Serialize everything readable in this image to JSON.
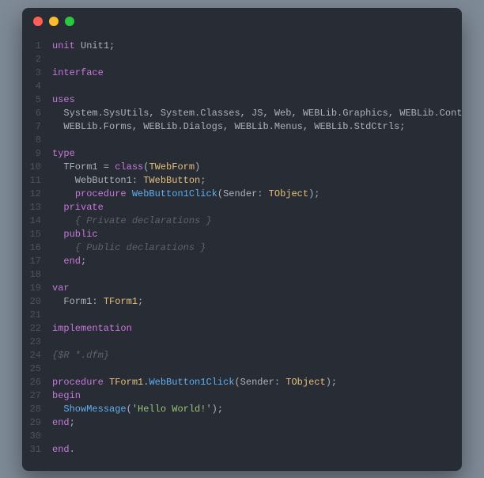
{
  "window": {
    "traffic_lights": [
      "close",
      "minimize",
      "zoom"
    ]
  },
  "code": {
    "lines": [
      {
        "num": "1",
        "tokens": [
          [
            "kw",
            "unit"
          ],
          [
            "id",
            " Unit1"
          ],
          [
            "pun",
            ";"
          ]
        ]
      },
      {
        "num": "2",
        "tokens": []
      },
      {
        "num": "3",
        "tokens": [
          [
            "kw",
            "interface"
          ]
        ]
      },
      {
        "num": "4",
        "tokens": []
      },
      {
        "num": "5",
        "tokens": [
          [
            "kw",
            "uses"
          ]
        ]
      },
      {
        "num": "6",
        "tokens": [
          [
            "id",
            "  System.SysUtils, System.Classes, JS, Web, WEBLib.Graphics, WEBLib.Controls,"
          ]
        ]
      },
      {
        "num": "7",
        "tokens": [
          [
            "id",
            "  WEBLib.Forms, WEBLib.Dialogs, WEBLib.Menus, WEBLib.StdCtrls;"
          ]
        ]
      },
      {
        "num": "8",
        "tokens": []
      },
      {
        "num": "9",
        "tokens": [
          [
            "kw",
            "type"
          ]
        ]
      },
      {
        "num": "10",
        "tokens": [
          [
            "id",
            "  TForm1 = "
          ],
          [
            "kw",
            "class"
          ],
          [
            "pun",
            "("
          ],
          [
            "cls",
            "TWebForm"
          ],
          [
            "pun",
            ")"
          ]
        ]
      },
      {
        "num": "11",
        "tokens": [
          [
            "id",
            "    WebButton1: "
          ],
          [
            "cls",
            "TWebButton"
          ],
          [
            "pun",
            ";"
          ]
        ]
      },
      {
        "num": "12",
        "tokens": [
          [
            "id",
            "    "
          ],
          [
            "kw",
            "procedure"
          ],
          [
            "id",
            " "
          ],
          [
            "fn",
            "WebButton1Click"
          ],
          [
            "pun",
            "("
          ],
          [
            "id",
            "Sender: "
          ],
          [
            "cls",
            "TObject"
          ],
          [
            "pun",
            ");"
          ]
        ]
      },
      {
        "num": "13",
        "tokens": [
          [
            "id",
            "  "
          ],
          [
            "kw",
            "private"
          ]
        ]
      },
      {
        "num": "14",
        "tokens": [
          [
            "id",
            "    "
          ],
          [
            "cmt",
            "{ Private declarations }"
          ]
        ]
      },
      {
        "num": "15",
        "tokens": [
          [
            "id",
            "  "
          ],
          [
            "kw",
            "public"
          ]
        ]
      },
      {
        "num": "16",
        "tokens": [
          [
            "id",
            "    "
          ],
          [
            "cmt",
            "{ Public declarations }"
          ]
        ]
      },
      {
        "num": "17",
        "tokens": [
          [
            "id",
            "  "
          ],
          [
            "kw",
            "end"
          ],
          [
            "pun",
            ";"
          ]
        ]
      },
      {
        "num": "18",
        "tokens": []
      },
      {
        "num": "19",
        "tokens": [
          [
            "kw",
            "var"
          ]
        ]
      },
      {
        "num": "20",
        "tokens": [
          [
            "id",
            "  Form1: "
          ],
          [
            "cls",
            "TForm1"
          ],
          [
            "pun",
            ";"
          ]
        ]
      },
      {
        "num": "21",
        "tokens": []
      },
      {
        "num": "22",
        "tokens": [
          [
            "kw",
            "implementation"
          ]
        ]
      },
      {
        "num": "23",
        "tokens": []
      },
      {
        "num": "24",
        "tokens": [
          [
            "cmt",
            "{$R *.dfm}"
          ]
        ]
      },
      {
        "num": "25",
        "tokens": []
      },
      {
        "num": "26",
        "tokens": [
          [
            "kw",
            "procedure"
          ],
          [
            "id",
            " "
          ],
          [
            "cls",
            "TForm1"
          ],
          [
            "pun",
            "."
          ],
          [
            "fn",
            "WebButton1Click"
          ],
          [
            "pun",
            "("
          ],
          [
            "id",
            "Sender: "
          ],
          [
            "cls",
            "TObject"
          ],
          [
            "pun",
            ");"
          ]
        ]
      },
      {
        "num": "27",
        "tokens": [
          [
            "kw",
            "begin"
          ]
        ]
      },
      {
        "num": "28",
        "tokens": [
          [
            "id",
            "  "
          ],
          [
            "fn",
            "ShowMessage"
          ],
          [
            "pun",
            "("
          ],
          [
            "str",
            "'Hello World!'"
          ],
          [
            "pun",
            ");"
          ]
        ]
      },
      {
        "num": "29",
        "tokens": [
          [
            "kw",
            "end"
          ],
          [
            "pun",
            ";"
          ]
        ]
      },
      {
        "num": "30",
        "tokens": []
      },
      {
        "num": "31",
        "tokens": [
          [
            "kw",
            "end"
          ],
          [
            "pun",
            "."
          ]
        ]
      }
    ]
  }
}
